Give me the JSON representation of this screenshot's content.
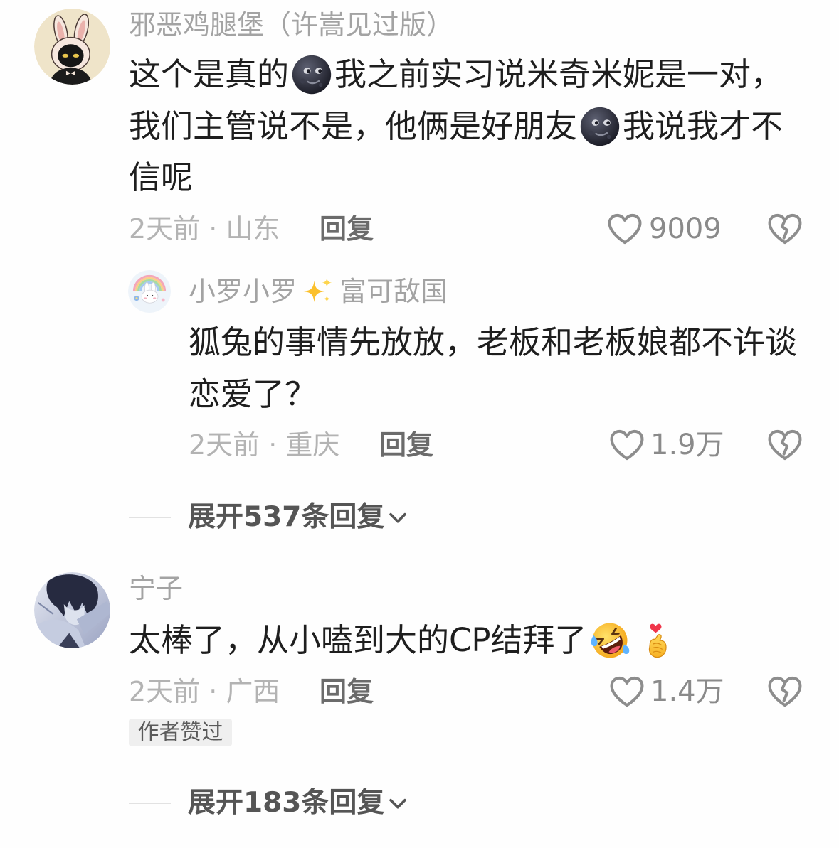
{
  "colors": {
    "username": "#a3a3a3",
    "text": "#1e1e1e",
    "meta": "#b3b3b3",
    "reply": "#6b6b6b",
    "icon": "#8d8d8d",
    "badge_bg": "#efefef"
  },
  "comments": [
    {
      "avatar_icon": "bunny-hood-cat-avatar",
      "user": "邪恶鸡腿堡（许嵩见过版）",
      "lines": [
        [
          {
            "text": "这个是真的"
          },
          {
            "emoji": "new-moon-face-emoji"
          },
          {
            "text": "我之前实习说米奇米妮是一对，"
          }
        ],
        [
          {
            "text": "我们主管说不是，他俩是好朋友"
          },
          {
            "emoji": "new-moon-face-emoji"
          },
          {
            "text": "我说我才不"
          }
        ],
        [
          {
            "text": "信呢"
          }
        ]
      ],
      "meta": "2天前 · 山东",
      "reply_label": "回复",
      "like_icon": "heart-outline-icon",
      "likes": "9009",
      "dislike_icon": "broken-heart-icon",
      "replies": [
        {
          "avatar_icon": "rainbow-bunny-avatar",
          "user": [
            {
              "text": "小罗小罗"
            },
            {
              "emoji": "sparkles-emoji"
            },
            {
              "text": "富可敌国"
            }
          ],
          "lines": [
            [
              {
                "text": "狐兔的事情先放放，老板和老板娘都不许谈"
              }
            ],
            [
              {
                "text": "恋爱了？"
              }
            ]
          ],
          "meta": "2天前 · 重庆",
          "reply_label": "回复",
          "likes": "1.9万"
        }
      ],
      "expand_label": "展开537条回复",
      "expand_icon": "chevron-down-icon"
    },
    {
      "avatar_icon": "anime-boy-avatar",
      "user": "宁子",
      "lines": [
        [
          {
            "text": "太棒了，从小嗑到大的CP结拜了"
          },
          {
            "emoji": "rolling-on-floor-laughing-emoji"
          },
          {
            "emoji": "finger-heart-emoji"
          }
        ]
      ],
      "meta": "2天前 · 广西",
      "reply_label": "回复",
      "likes": "1.4万",
      "badge": "作者赞过",
      "expand_label": "展开183条回复",
      "expand_icon": "chevron-down-icon"
    }
  ]
}
